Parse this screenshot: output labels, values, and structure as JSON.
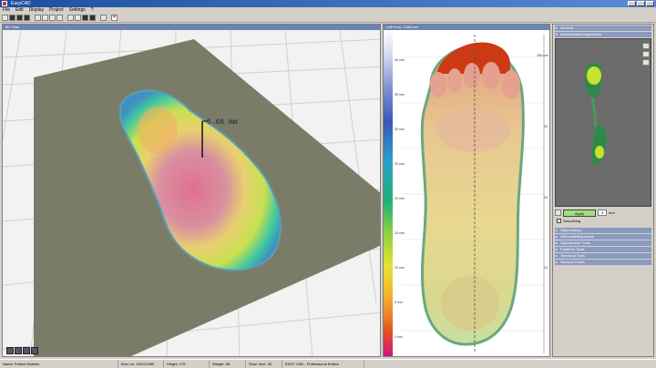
{
  "window": {
    "title": "EasyCAD"
  },
  "menu": [
    "File",
    "Edit",
    "Display",
    "Project",
    "Settings",
    "?"
  ],
  "view3d": {
    "title": "3D View",
    "measurement": "5.66 mm"
  },
  "view2d": {
    "title": "Left Foot - 5.66 mm",
    "scale_labels": [
      "40 mm",
      "35 mm",
      "30 mm",
      "25 mm",
      "20 mm",
      "15 mm",
      "10 mm",
      "5 mm",
      "0 mm"
    ],
    "ruler_labels": [
      "256 mm",
      "30",
      "20",
      "10"
    ]
  },
  "rpanel": {
    "sections_top": [
      "General",
      "Instrumental Amputations"
    ],
    "apply_label": "Apply",
    "spin_value": "3",
    "unit_label": "mm",
    "smoothing_label": "Smoothing",
    "sections_bottom": [
      "Object library",
      "Self-modelling insole",
      "Optimization Tools",
      "Posterior Tools",
      "Technical Tools",
      "Sensors Points"
    ]
  },
  "status": {
    "fields": [
      "Name: Patient Modello",
      "Born on: 19/12/1965",
      "Height: 175",
      "Weight: 68",
      "Shoe Size: 35",
      "EASY CAD - Professional Edition"
    ]
  },
  "colors": {
    "titlebar": "#1b4fa0",
    "board": "#7a7c68",
    "preview_bg": "#6c6c6c",
    "apply": "#9fe07a"
  }
}
